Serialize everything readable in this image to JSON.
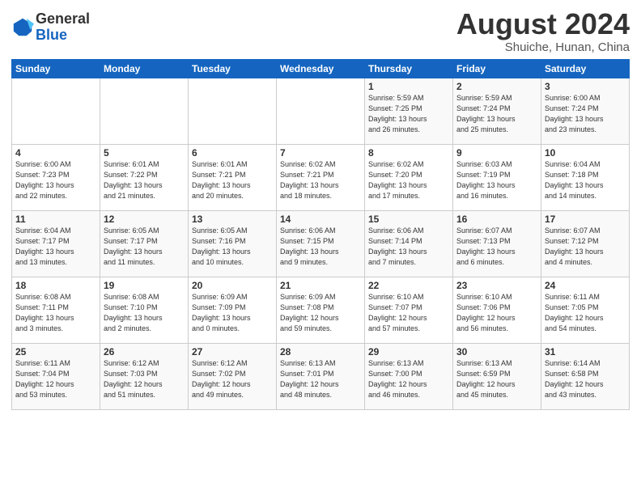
{
  "header": {
    "logo_general": "General",
    "logo_blue": "Blue",
    "month_year": "August 2024",
    "location": "Shuiche, Hunan, China"
  },
  "weekdays": [
    "Sunday",
    "Monday",
    "Tuesday",
    "Wednesday",
    "Thursday",
    "Friday",
    "Saturday"
  ],
  "weeks": [
    [
      {
        "day": "",
        "info": ""
      },
      {
        "day": "",
        "info": ""
      },
      {
        "day": "",
        "info": ""
      },
      {
        "day": "",
        "info": ""
      },
      {
        "day": "1",
        "info": "Sunrise: 5:59 AM\nSunset: 7:25 PM\nDaylight: 13 hours\nand 26 minutes."
      },
      {
        "day": "2",
        "info": "Sunrise: 5:59 AM\nSunset: 7:24 PM\nDaylight: 13 hours\nand 25 minutes."
      },
      {
        "day": "3",
        "info": "Sunrise: 6:00 AM\nSunset: 7:24 PM\nDaylight: 13 hours\nand 23 minutes."
      }
    ],
    [
      {
        "day": "4",
        "info": "Sunrise: 6:00 AM\nSunset: 7:23 PM\nDaylight: 13 hours\nand 22 minutes."
      },
      {
        "day": "5",
        "info": "Sunrise: 6:01 AM\nSunset: 7:22 PM\nDaylight: 13 hours\nand 21 minutes."
      },
      {
        "day": "6",
        "info": "Sunrise: 6:01 AM\nSunset: 7:21 PM\nDaylight: 13 hours\nand 20 minutes."
      },
      {
        "day": "7",
        "info": "Sunrise: 6:02 AM\nSunset: 7:21 PM\nDaylight: 13 hours\nand 18 minutes."
      },
      {
        "day": "8",
        "info": "Sunrise: 6:02 AM\nSunset: 7:20 PM\nDaylight: 13 hours\nand 17 minutes."
      },
      {
        "day": "9",
        "info": "Sunrise: 6:03 AM\nSunset: 7:19 PM\nDaylight: 13 hours\nand 16 minutes."
      },
      {
        "day": "10",
        "info": "Sunrise: 6:04 AM\nSunset: 7:18 PM\nDaylight: 13 hours\nand 14 minutes."
      }
    ],
    [
      {
        "day": "11",
        "info": "Sunrise: 6:04 AM\nSunset: 7:17 PM\nDaylight: 13 hours\nand 13 minutes."
      },
      {
        "day": "12",
        "info": "Sunrise: 6:05 AM\nSunset: 7:17 PM\nDaylight: 13 hours\nand 11 minutes."
      },
      {
        "day": "13",
        "info": "Sunrise: 6:05 AM\nSunset: 7:16 PM\nDaylight: 13 hours\nand 10 minutes."
      },
      {
        "day": "14",
        "info": "Sunrise: 6:06 AM\nSunset: 7:15 PM\nDaylight: 13 hours\nand 9 minutes."
      },
      {
        "day": "15",
        "info": "Sunrise: 6:06 AM\nSunset: 7:14 PM\nDaylight: 13 hours\nand 7 minutes."
      },
      {
        "day": "16",
        "info": "Sunrise: 6:07 AM\nSunset: 7:13 PM\nDaylight: 13 hours\nand 6 minutes."
      },
      {
        "day": "17",
        "info": "Sunrise: 6:07 AM\nSunset: 7:12 PM\nDaylight: 13 hours\nand 4 minutes."
      }
    ],
    [
      {
        "day": "18",
        "info": "Sunrise: 6:08 AM\nSunset: 7:11 PM\nDaylight: 13 hours\nand 3 minutes."
      },
      {
        "day": "19",
        "info": "Sunrise: 6:08 AM\nSunset: 7:10 PM\nDaylight: 13 hours\nand 2 minutes."
      },
      {
        "day": "20",
        "info": "Sunrise: 6:09 AM\nSunset: 7:09 PM\nDaylight: 13 hours\nand 0 minutes."
      },
      {
        "day": "21",
        "info": "Sunrise: 6:09 AM\nSunset: 7:08 PM\nDaylight: 12 hours\nand 59 minutes."
      },
      {
        "day": "22",
        "info": "Sunrise: 6:10 AM\nSunset: 7:07 PM\nDaylight: 12 hours\nand 57 minutes."
      },
      {
        "day": "23",
        "info": "Sunrise: 6:10 AM\nSunset: 7:06 PM\nDaylight: 12 hours\nand 56 minutes."
      },
      {
        "day": "24",
        "info": "Sunrise: 6:11 AM\nSunset: 7:05 PM\nDaylight: 12 hours\nand 54 minutes."
      }
    ],
    [
      {
        "day": "25",
        "info": "Sunrise: 6:11 AM\nSunset: 7:04 PM\nDaylight: 12 hours\nand 53 minutes."
      },
      {
        "day": "26",
        "info": "Sunrise: 6:12 AM\nSunset: 7:03 PM\nDaylight: 12 hours\nand 51 minutes."
      },
      {
        "day": "27",
        "info": "Sunrise: 6:12 AM\nSunset: 7:02 PM\nDaylight: 12 hours\nand 49 minutes."
      },
      {
        "day": "28",
        "info": "Sunrise: 6:13 AM\nSunset: 7:01 PM\nDaylight: 12 hours\nand 48 minutes."
      },
      {
        "day": "29",
        "info": "Sunrise: 6:13 AM\nSunset: 7:00 PM\nDaylight: 12 hours\nand 46 minutes."
      },
      {
        "day": "30",
        "info": "Sunrise: 6:13 AM\nSunset: 6:59 PM\nDaylight: 12 hours\nand 45 minutes."
      },
      {
        "day": "31",
        "info": "Sunrise: 6:14 AM\nSunset: 6:58 PM\nDaylight: 12 hours\nand 43 minutes."
      }
    ]
  ]
}
